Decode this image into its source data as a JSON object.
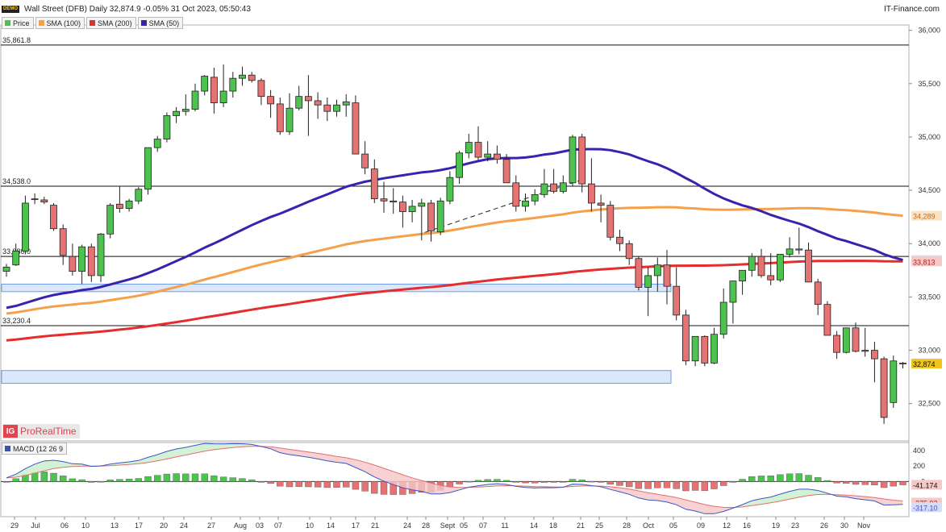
{
  "header": {
    "demo_label": "DEMO",
    "title": "Wall Street (DFB) Daily 32,874.9 -0.05% 31 Oct 2023, 05:50:43",
    "site": "IT-Finance.com"
  },
  "legend": [
    {
      "label": "Price",
      "color": "#5cb85c"
    },
    {
      "label": "SMA (100)",
      "color": "#f5a04a"
    },
    {
      "label": "SMA (200)",
      "color": "#e52d2d"
    },
    {
      "label": "SMA (50)",
      "color": "#3a22b0"
    }
  ],
  "watermark": {
    "logo": "IG",
    "text": "ProRealTime"
  },
  "macd_legend": {
    "label": "MACD (12 26 9",
    "color": "#3b55a0"
  },
  "colors": {
    "up": "#4ec24e",
    "down": "#e57373",
    "sma50": "#3a22b0",
    "sma100": "#f5a04a",
    "sma200": "#e52d2d"
  },
  "chart_data": {
    "type": "candlestick",
    "y_axis": {
      "ticks": [
        32500,
        33000,
        33500,
        34000,
        34500,
        35000,
        35500,
        36000
      ],
      "ylim": [
        32150,
        36050
      ]
    },
    "x_axis": {
      "labels": [
        "29",
        "Jul",
        "06",
        "10",
        "13",
        "17",
        "20",
        "24",
        "27",
        "Aug",
        "03",
        "07",
        "10",
        "14",
        "17",
        "21",
        "24",
        "28",
        "Sept",
        "05",
        "07",
        "11",
        "14",
        "18",
        "21",
        "25",
        "28",
        "Oct",
        "05",
        "09",
        "12",
        "16",
        "19",
        "23",
        "26",
        "30",
        "Nov"
      ]
    },
    "levels": [
      {
        "label": "35,861.8",
        "value": 35861.8
      },
      {
        "label": "34,538.0",
        "value": 34538.0
      },
      {
        "label": "33,880.0",
        "value": 33880.0
      },
      {
        "label": "33,230.4",
        "value": 33230.4
      }
    ],
    "zones": [
      {
        "from": 33550,
        "to": 33620,
        "x_end": "28"
      },
      {
        "from": 32690,
        "to": 32810,
        "x_end": "28"
      }
    ],
    "trendline": {
      "from": {
        "x": "24",
        "y": 34080
      },
      "to": {
        "x": "20",
        "y": 34600
      }
    },
    "candles": [
      [
        33740,
        33810,
        33690,
        33780
      ],
      [
        33800,
        34000,
        33790,
        33930
      ],
      [
        33930,
        34450,
        33900,
        34380
      ],
      [
        34420,
        34470,
        34370,
        34420
      ],
      [
        34410,
        34440,
        34370,
        34390
      ],
      [
        34360,
        34380,
        34120,
        34140
      ],
      [
        34140,
        34180,
        33800,
        33890
      ],
      [
        33880,
        34000,
        33700,
        33740
      ],
      [
        33740,
        33990,
        33620,
        33970
      ],
      [
        33970,
        34000,
        33640,
        33700
      ],
      [
        33700,
        34100,
        33640,
        34090
      ],
      [
        34090,
        34380,
        34050,
        34360
      ],
      [
        34370,
        34540,
        34290,
        34330
      ],
      [
        34330,
        34420,
        34300,
        34400
      ],
      [
        34400,
        34530,
        34370,
        34510
      ],
      [
        34510,
        34880,
        34460,
        34900
      ],
      [
        34900,
        35010,
        34860,
        34980
      ],
      [
        34980,
        35230,
        34950,
        35200
      ],
      [
        35200,
        35280,
        35130,
        35240
      ],
      [
        35240,
        35400,
        35200,
        35260
      ],
      [
        35260,
        35500,
        35240,
        35430
      ],
      [
        35430,
        35580,
        35390,
        35570
      ],
      [
        35560,
        35650,
        35220,
        35320
      ],
      [
        35320,
        35680,
        35280,
        35430
      ],
      [
        35430,
        35610,
        35370,
        35550
      ],
      [
        35550,
        35660,
        35480,
        35580
      ],
      [
        35580,
        35610,
        35510,
        35530
      ],
      [
        35530,
        35550,
        35300,
        35380
      ],
      [
        35380,
        35440,
        35180,
        35310
      ],
      [
        35310,
        35370,
        35020,
        35050
      ],
      [
        35050,
        35410,
        35020,
        35270
      ],
      [
        35270,
        35480,
        35250,
        35380
      ],
      [
        35380,
        35580,
        35010,
        35340
      ],
      [
        35340,
        35420,
        35170,
        35300
      ],
      [
        35300,
        35370,
        35150,
        35240
      ],
      [
        35240,
        35350,
        35190,
        35300
      ],
      [
        35300,
        35400,
        35190,
        35330
      ],
      [
        35320,
        35390,
        35000,
        34840
      ],
      [
        34840,
        34960,
        34650,
        34710
      ],
      [
        34700,
        34790,
        34380,
        34420
      ],
      [
        34420,
        34580,
        34290,
        34400
      ],
      [
        34400,
        34520,
        34280,
        34390
      ],
      [
        34390,
        34450,
        34150,
        34300
      ],
      [
        34300,
        34410,
        34200,
        34350
      ],
      [
        34350,
        34420,
        34030,
        34380
      ],
      [
        34380,
        34410,
        34020,
        34120
      ],
      [
        34110,
        34430,
        34080,
        34400
      ],
      [
        34400,
        34680,
        34370,
        34620
      ],
      [
        34620,
        34870,
        34560,
        34850
      ],
      [
        34850,
        35030,
        34800,
        34950
      ],
      [
        34950,
        35100,
        34780,
        34810
      ],
      [
        34810,
        34960,
        34770,
        34840
      ],
      [
        34840,
        34920,
        34750,
        34790
      ],
      [
        34790,
        34840,
        34600,
        34570
      ],
      [
        34570,
        34640,
        34300,
        34350
      ],
      [
        34350,
        34470,
        34300,
        34400
      ],
      [
        34400,
        34510,
        34360,
        34460
      ],
      [
        34460,
        34700,
        34430,
        34560
      ],
      [
        34560,
        34700,
        34470,
        34490
      ],
      [
        34490,
        34640,
        34470,
        34570
      ],
      [
        34570,
        35020,
        34540,
        35000
      ],
      [
        35000,
        35030,
        34480,
        34560
      ],
      [
        34560,
        34800,
        34300,
        34380
      ],
      [
        34380,
        34460,
        34200,
        34360
      ],
      [
        34360,
        34400,
        34030,
        34060
      ],
      [
        34060,
        34130,
        33930,
        34000
      ],
      [
        34000,
        34030,
        33800,
        33860
      ],
      [
        33860,
        33880,
        33560,
        33590
      ],
      [
        33590,
        33780,
        33320,
        33700
      ],
      [
        33700,
        33870,
        33550,
        33800
      ],
      [
        33800,
        33940,
        33430,
        33600
      ],
      [
        33600,
        33780,
        33280,
        33330
      ],
      [
        33330,
        33380,
        32860,
        32900
      ],
      [
        32900,
        33130,
        32850,
        33130
      ],
      [
        33130,
        33140,
        32850,
        32880
      ],
      [
        32880,
        33210,
        32870,
        33150
      ],
      [
        33150,
        33580,
        33110,
        33450
      ],
      [
        33450,
        33610,
        33250,
        33650
      ],
      [
        33650,
        33740,
        33520,
        33750
      ],
      [
        33750,
        33910,
        33690,
        33880
      ],
      [
        33880,
        33950,
        33680,
        33700
      ],
      [
        33700,
        33910,
        33610,
        33660
      ],
      [
        33660,
        33900,
        33640,
        33900
      ],
      [
        33900,
        34060,
        33870,
        33950
      ],
      [
        33950,
        34150,
        33900,
        33940
      ],
      [
        33940,
        34010,
        33660,
        33640
      ],
      [
        33640,
        33670,
        33330,
        33430
      ],
      [
        33430,
        33460,
        33210,
        33140
      ],
      [
        33140,
        33180,
        32920,
        32980
      ],
      [
        32980,
        33210,
        32970,
        33210
      ],
      [
        33210,
        33260,
        32980,
        32990
      ],
      [
        32990,
        33210,
        32940,
        33000
      ],
      [
        33000,
        33080,
        32700,
        32920
      ],
      [
        32920,
        32940,
        32310,
        32370
      ],
      [
        32510,
        32950,
        32460,
        32900
      ],
      [
        32880,
        32890,
        32830,
        32874.9
      ]
    ],
    "sma50_label": "33,922",
    "sma100_label": "34,289",
    "sma200_label": "33,813",
    "last_label": "32,874",
    "macd": {
      "ylim": [
        -420,
        470
      ],
      "ticks": [
        "400",
        "200",
        "0"
      ],
      "labels": {
        "macd": "-317.10",
        "signal": "-275.92",
        "hist": "-41.174"
      }
    }
  }
}
